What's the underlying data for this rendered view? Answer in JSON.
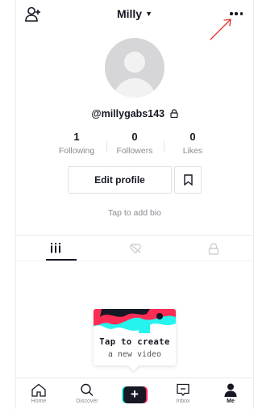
{
  "header": {
    "title": "Milly",
    "caret": "▼",
    "add_user_icon": "add-user-icon",
    "more_icon": "more-dots-icon"
  },
  "profile": {
    "username": "@millygabs143",
    "private_icon": "lock-icon",
    "stats": [
      {
        "value": "1",
        "label": "Following"
      },
      {
        "value": "0",
        "label": "Followers"
      },
      {
        "value": "0",
        "label": "Likes"
      }
    ],
    "edit_label": "Edit profile",
    "bookmark_icon": "bookmark-icon",
    "bio_placeholder": "Tap to add bio"
  },
  "tabs": [
    {
      "icon": "grid-icon",
      "active": true
    },
    {
      "icon": "liked-hidden-icon",
      "active": false
    },
    {
      "icon": "lock-icon",
      "active": false
    }
  ],
  "create_card": {
    "title": "Tap to create",
    "subtitle": "a new video"
  },
  "nav": {
    "items": [
      {
        "label": "Home",
        "icon": "home-icon",
        "active": false
      },
      {
        "label": "Discover",
        "icon": "search-icon",
        "active": false
      },
      {
        "label": "",
        "icon": "create-plus-icon",
        "active": false
      },
      {
        "label": "Inbox",
        "icon": "inbox-icon",
        "active": false
      },
      {
        "label": "Me",
        "icon": "profile-icon",
        "active": true
      }
    ]
  },
  "colors": {
    "text": "#161823",
    "secondary_text": "#8a8b91",
    "cyan": "#25f4ee",
    "pink": "#fe2c55",
    "annotation_red": "#e0352b"
  }
}
